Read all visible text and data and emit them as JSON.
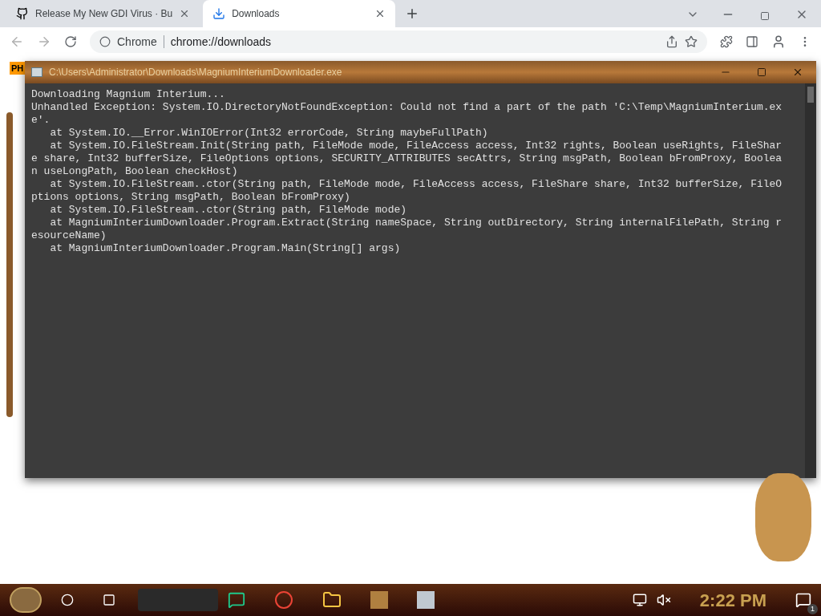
{
  "tabs": [
    {
      "label": "Release My New GDI Virus · Bu",
      "kind": "site",
      "selected": false
    },
    {
      "label": "Downloads",
      "kind": "download",
      "selected": true
    }
  ],
  "address": {
    "site": "Chrome",
    "url": "chrome://downloads"
  },
  "bookmarks": [
    {
      "label": "PH"
    }
  ],
  "console": {
    "title": "C:\\Users\\Administrator\\Downloads\\MagniumInteriumDownloader.exe",
    "lines": [
      "Downloading Magnium Interium...",
      "Unhandled Exception: System.IO.DirectoryNotFoundException: Could not find a part of the path 'C:\\Temp\\MagniumInterium.ex",
      "e'.",
      "   at System.IO.__Error.WinIOError(Int32 errorCode, String maybeFullPath)",
      "   at System.IO.FileStream.Init(String path, FileMode mode, FileAccess access, Int32 rights, Boolean useRights, FileShar",
      "e share, Int32 bufferSize, FileOptions options, SECURITY_ATTRIBUTES secAttrs, String msgPath, Boolean bFromProxy, Boolea",
      "n useLongPath, Boolean checkHost)",
      "   at System.IO.FileStream..ctor(String path, FileMode mode, FileAccess access, FileShare share, Int32 bufferSize, FileO",
      "ptions options, String msgPath, Boolean bFromProxy)",
      "   at System.IO.FileStream..ctor(String path, FileMode mode)",
      "   at MagniumInteriumDownloader.Program.Extract(String nameSpace, String outDirectory, String internalFilePath, String r",
      "esourceName)",
      "   at MagniumInteriumDownloader.Program.Main(String[] args)"
    ]
  },
  "taskbar": {
    "clock": "2:22 PM",
    "notification_count": "1"
  }
}
